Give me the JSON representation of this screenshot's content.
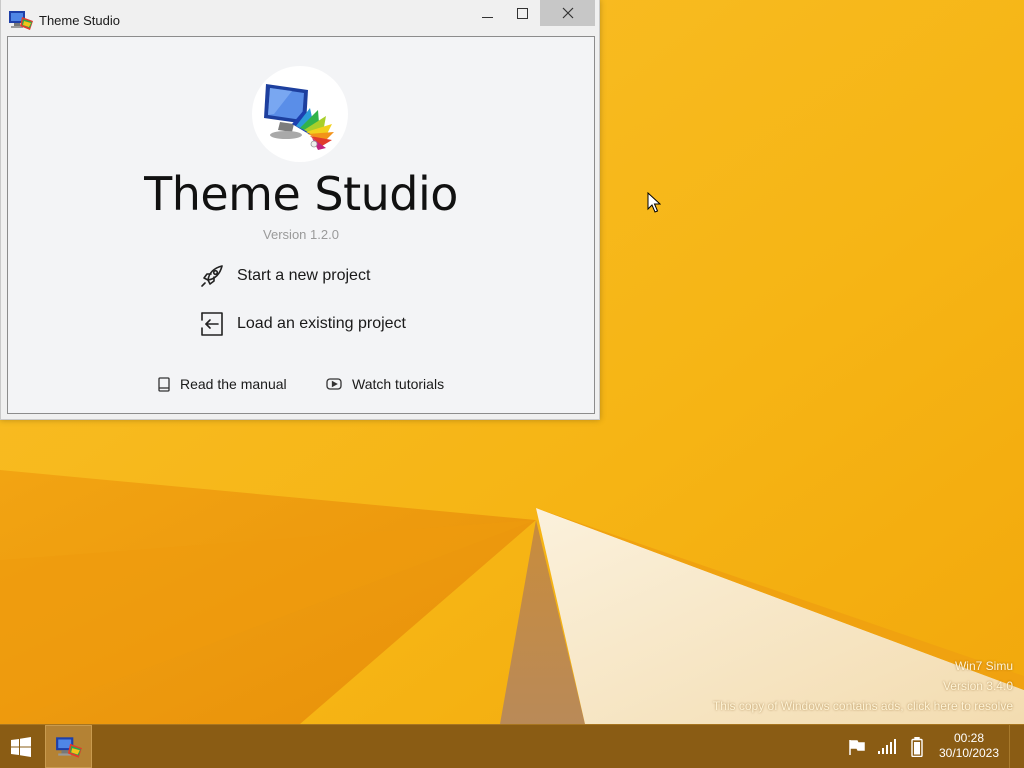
{
  "window": {
    "title": "Theme Studio",
    "app_name": "Theme Studio",
    "version": "Version 1.2.0",
    "actions": [
      {
        "label": "Start a new project",
        "icon": "rocket-icon"
      },
      {
        "label": "Load an existing project",
        "icon": "import-icon"
      }
    ],
    "links": [
      {
        "label": "Read the manual",
        "icon": "book-icon"
      },
      {
        "label": "Watch tutorials",
        "icon": "play-icon"
      }
    ]
  },
  "watermark": {
    "line1": "Win7 Simu",
    "line2": "Version 3.4.0",
    "line3": "This copy of Windows contains ads, click here to resolve"
  },
  "taskbar": {
    "time": "00:28",
    "date": "30/10/2023"
  },
  "colors": {
    "wallpaper": "#f5b719",
    "taskbar": "#8a5c14",
    "close_button": "#c7c7c7"
  }
}
